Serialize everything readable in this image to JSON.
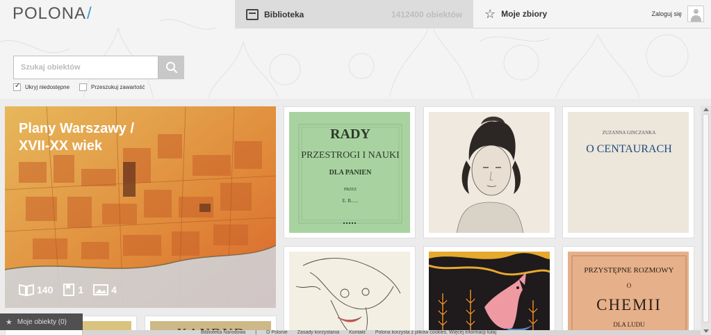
{
  "header": {
    "logo": "POLONA",
    "logo_slash": "/",
    "library_label": "Biblioteka",
    "library_count": "1412400 obiektów",
    "favorites_label": "Moje zbiory",
    "login_label": "Zaloguj się"
  },
  "search": {
    "placeholder": "Szukaj obiektów",
    "options": [
      {
        "label": "Ukryj niedostępne",
        "checked": true
      },
      {
        "label": "Przeszukuj zawartość",
        "checked": false
      }
    ]
  },
  "featured": {
    "title": "Plany Warszawy /\nXVII-XX wiek",
    "books_count": "140",
    "documents_count": "1",
    "images_count": "4"
  },
  "cards": [
    {
      "lines": [
        "RADY",
        "PRZESTROGI I NAUKI",
        "DLA PANIEN",
        "PRZEZ",
        "E. B......"
      ]
    },
    {
      "lines": []
    },
    {
      "lines": [
        "ZUZANNA GINCZANKA",
        "O CENTAURACH"
      ]
    },
    {
      "lines": []
    },
    {
      "lines": []
    },
    {
      "lines": [
        "PRZYSTĘPNE ROZMOWY",
        "O",
        "CHEMII",
        "DLA LUDU"
      ]
    },
    {
      "lines": []
    },
    {
      "lines": [
        "KANDYD"
      ]
    }
  ],
  "bottom_panel": {
    "label": "Moje obiekty (0)"
  },
  "footer": {
    "links": [
      "Biblioteka Narodowa",
      "|",
      "O Polonie",
      "Zasady korzystania",
      "Kontakt",
      "Polona korzysta z plików cookies. Więcej informacji tutaj"
    ]
  },
  "colors": {
    "accent": "#2fa0c9",
    "featured_overlay": "#e0a040"
  }
}
